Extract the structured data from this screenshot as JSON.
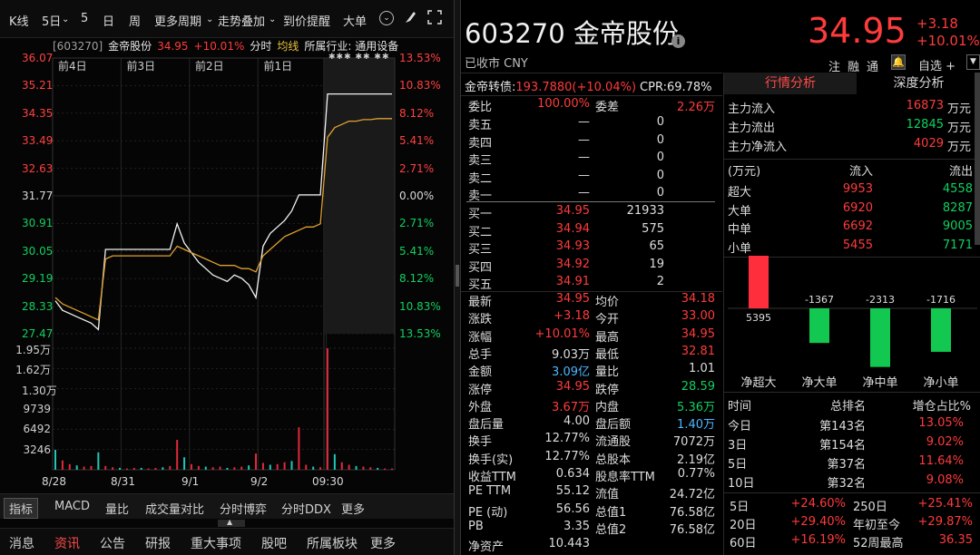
{
  "toolbar": {
    "items": [
      "K线",
      "5日",
      "5",
      "日",
      "周",
      "更多周期",
      "走势叠加",
      "到价提醒",
      "大单"
    ]
  },
  "info": {
    "code": "[603270]",
    "name": "金帝股份",
    "price": "34.95",
    "pct": "+10.01%",
    "tab_time": "分时",
    "tab_avg": "均线",
    "industry": "所属行业: 通用设备"
  },
  "chart": {
    "day_labels": [
      "前4日",
      "前3日",
      "前2日",
      "前1日"
    ],
    "price_ticks": [
      "36.07",
      "35.21",
      "34.35",
      "33.49",
      "32.63",
      "31.77",
      "30.91",
      "30.05",
      "29.19",
      "28.33",
      "27.47"
    ],
    "pct_ticks": [
      "13.53%",
      "10.83%",
      "8.12%",
      "5.41%",
      "2.71%",
      "0.00%",
      "2.71%",
      "5.41%",
      "8.12%",
      "10.83%",
      "13.53%"
    ],
    "vol_ticks": [
      "1.95万",
      "1.62万",
      "1.30万",
      "9739",
      "6492",
      "3246"
    ],
    "x_labels": [
      "8/28",
      "8/31",
      "9/1",
      "9/2",
      "09:30"
    ]
  },
  "chart_data": {
    "type": "line",
    "price_range": [
      27.47,
      36.07
    ],
    "pre_close": 31.77,
    "series": [
      {
        "name": "分时",
        "values": [
          28.5,
          28.2,
          28.1,
          28.0,
          27.9,
          27.8,
          27.6,
          30.1,
          30.1,
          30.1,
          30.1,
          30.1,
          30.1,
          30.1,
          30.1,
          30.1,
          30.1,
          30.9,
          30.3,
          30.0,
          29.7,
          29.5,
          29.3,
          29.2,
          29.1,
          29.3,
          29.2,
          29.0,
          28.6,
          30.2,
          30.6,
          30.8,
          31.0,
          31.3,
          31.8,
          31.8,
          31.8,
          31.8,
          34.95,
          34.95,
          34.95,
          34.95,
          34.95,
          34.95,
          34.95,
          34.95,
          34.95,
          34.95
        ]
      },
      {
        "name": "均线",
        "values": [
          28.6,
          28.4,
          28.3,
          28.2,
          28.1,
          28.0,
          27.9,
          29.8,
          29.9,
          29.9,
          29.9,
          29.9,
          29.9,
          29.9,
          29.9,
          29.9,
          29.9,
          30.2,
          30.1,
          30.0,
          29.9,
          29.8,
          29.7,
          29.6,
          29.6,
          29.6,
          29.5,
          29.5,
          29.4,
          29.9,
          30.1,
          30.3,
          30.5,
          30.6,
          30.7,
          30.8,
          30.8,
          30.9,
          33.6,
          33.9,
          34.0,
          34.1,
          34.1,
          34.15,
          34.15,
          34.18,
          34.18,
          34.18
        ]
      }
    ],
    "volume": {
      "max": 19500,
      "values": [
        3200,
        1500,
        900,
        700,
        500,
        600,
        2800,
        600,
        400,
        300,
        200,
        300,
        300,
        200,
        300,
        400,
        600,
        4800,
        2000,
        900,
        600,
        500,
        400,
        500,
        300,
        400,
        500,
        700,
        2600,
        1100,
        800,
        900,
        1200,
        1400,
        6800,
        800,
        500,
        400,
        19500,
        2500,
        1200,
        800,
        600,
        500,
        400,
        300,
        200,
        200
      ]
    }
  },
  "bottom_tabs": [
    "指标",
    "MACD",
    "量比",
    "成交量对比",
    "分时博弈",
    "分时DDX",
    "更多"
  ],
  "nav_tabs": [
    "消息",
    "资讯",
    "公告",
    "研报",
    "重大事项",
    "股吧",
    "所属板块",
    "更多"
  ],
  "quote": {
    "title": "603270 金帝股份",
    "price": "34.95",
    "chg": "+3.18",
    "pct": "+10.01%",
    "status": "已收市 CNY",
    "actions": [
      "注",
      "融",
      "通"
    ],
    "watch": "自选 +",
    "bond": "金帝转债:",
    "bond_val": "193.7880(+10.04%)",
    "cpr": "CPR:69.78%",
    "webi_label": "委比",
    "webi": "100.00%",
    "weicha_label": "委差",
    "weicha": "2.26万",
    "asks": [
      {
        "l": "卖五",
        "p": "—",
        "v": "0"
      },
      {
        "l": "卖四",
        "p": "—",
        "v": "0"
      },
      {
        "l": "卖三",
        "p": "—",
        "v": "0"
      },
      {
        "l": "卖二",
        "p": "—",
        "v": "0"
      },
      {
        "l": "卖一",
        "p": "—",
        "v": "0"
      }
    ],
    "bids": [
      {
        "l": "买一",
        "p": "34.95",
        "v": "21933"
      },
      {
        "l": "买二",
        "p": "34.94",
        "v": "575"
      },
      {
        "l": "买三",
        "p": "34.93",
        "v": "65"
      },
      {
        "l": "买四",
        "p": "34.92",
        "v": "19"
      },
      {
        "l": "买五",
        "p": "34.91",
        "v": "2"
      }
    ],
    "stats": [
      [
        "最新",
        "34.95",
        "red",
        "均价",
        "34.18",
        "red"
      ],
      [
        "涨跌",
        "+3.18",
        "red",
        "今开",
        "33.00",
        "red"
      ],
      [
        "涨幅",
        "+10.01%",
        "red",
        "最高",
        "34.95",
        "red"
      ],
      [
        "总手",
        "9.03万",
        "white",
        "最低",
        "32.81",
        "red"
      ],
      [
        "金额",
        "3.09亿",
        "cyan",
        "量比",
        "1.01",
        "white"
      ],
      [
        "涨停",
        "34.95",
        "red",
        "跌停",
        "28.59",
        "green"
      ],
      [
        "外盘",
        "3.67万",
        "red",
        "内盘",
        "5.36万",
        "green"
      ],
      [
        "盘后量",
        "4.00",
        "white",
        "盘后额",
        "1.40万",
        "cyan"
      ],
      [
        "换手",
        "12.77%",
        "white",
        "流通股",
        "7072万",
        "white"
      ],
      [
        "换手(实)",
        "12.77%",
        "white",
        "总股本",
        "2.19亿",
        "white"
      ],
      [
        "收益TTM",
        "0.634",
        "white",
        "股息率TTM",
        "0.77%",
        "white"
      ],
      [
        "PE TTM",
        "55.12",
        "white",
        "流值",
        "24.72亿",
        "white"
      ],
      [
        "PE (动)",
        "56.56",
        "white",
        "总值1",
        "76.58亿",
        "white"
      ],
      [
        "PB",
        "3.35",
        "white",
        "总值2",
        "76.58亿",
        "white"
      ],
      [
        "净资产",
        "10.443",
        "white",
        "",
        "",
        ""
      ]
    ]
  },
  "analysis": {
    "tabs": [
      "行情分析",
      "深度分析"
    ],
    "flow": [
      [
        "主力流入",
        "16873",
        "red",
        "万元"
      ],
      [
        "主力流出",
        "12845",
        "green",
        "万元"
      ],
      [
        "主力净流入",
        "4029",
        "red",
        "万元"
      ]
    ],
    "head": [
      "(万元)",
      "流入",
      "流出"
    ],
    "orders": [
      [
        "超大",
        "9953",
        "4558"
      ],
      [
        "大单",
        "6920",
        "8287"
      ],
      [
        "中单",
        "6692",
        "9005"
      ],
      [
        "小单",
        "5455",
        "7171"
      ]
    ],
    "bar_values": [
      5395,
      -1367,
      -2313,
      -1716
    ],
    "bar_labels": [
      "5395",
      "-1367",
      "-2313",
      "-1716"
    ],
    "bar_names": [
      "净超大",
      "净大单",
      "净中单",
      "净小单"
    ],
    "rank_head": [
      "时间",
      "总排名",
      "增仓占比%"
    ],
    "ranks": [
      [
        "今日",
        "第143名",
        "13.05%"
      ],
      [
        "3日",
        "第154名",
        "9.02%"
      ],
      [
        "5日",
        "第37名",
        "11.64%"
      ],
      [
        "10日",
        "第32名",
        "9.08%"
      ]
    ],
    "periods": [
      [
        "5日",
        "+24.60%",
        "250日",
        "+25.41%"
      ],
      [
        "20日",
        "+29.40%",
        "年初至今",
        "+29.87%"
      ],
      [
        "60日",
        "+16.19%",
        "52周最高",
        "36.35"
      ]
    ]
  }
}
